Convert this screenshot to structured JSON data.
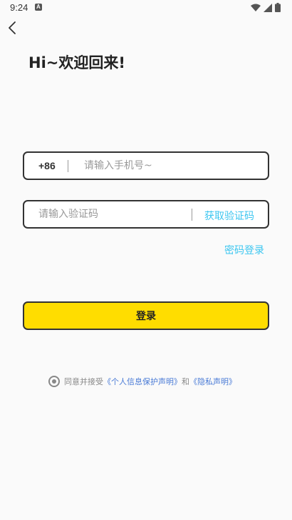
{
  "status_bar": {
    "time": "9:24",
    "notification_glyph": "A",
    "icons": [
      "wifi-icon",
      "signal-icon",
      "battery-icon"
    ]
  },
  "header": {
    "back_icon": "chevron-left-icon",
    "title": "Hi~欢迎回来!"
  },
  "phone_field": {
    "country_code": "+86",
    "placeholder": "请输入手机号~",
    "value": ""
  },
  "code_field": {
    "placeholder": "请输入验证码",
    "value": "",
    "get_code_label": "获取验证码"
  },
  "password_login_label": "密码登录",
  "login_button_label": "登录",
  "agreement": {
    "checked": true,
    "prefix": "同意并接受",
    "privacy_protection_link": "《个人信息保护声明》",
    "conjunction": "和",
    "privacy_statement_link": "《隐私声明》"
  },
  "colors": {
    "background": "#fafafa",
    "accent_yellow": "#ffdd00",
    "link_cyan": "#3cc6f0",
    "link_blue": "#4a7bd6",
    "border_dark": "#333333"
  }
}
